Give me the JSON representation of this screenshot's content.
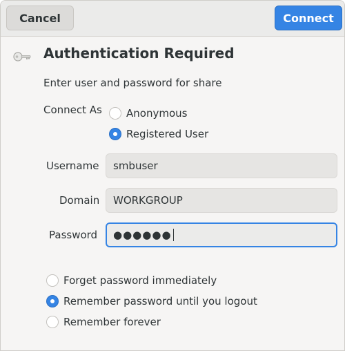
{
  "header": {
    "cancel_label": "Cancel",
    "connect_label": "Connect"
  },
  "dialog": {
    "title": "Authentication Required",
    "subtitle": "Enter user and password for share"
  },
  "connect_as": {
    "label": "Connect As",
    "options": [
      {
        "label": "Anonymous",
        "selected": false
      },
      {
        "label": "Registered User",
        "selected": true
      }
    ]
  },
  "fields": {
    "username_label": "Username",
    "username_value": "smbuser",
    "domain_label": "Domain",
    "domain_value": "WORKGROUP",
    "password_label": "Password",
    "password_masked": "●●●●●●"
  },
  "remember": {
    "options": [
      {
        "label": "Forget password immediately",
        "selected": false
      },
      {
        "label": "Remember password until you logout",
        "selected": true
      },
      {
        "label": "Remember forever",
        "selected": false
      }
    ]
  },
  "colors": {
    "accent": "#3584e4",
    "background": "#f6f5f4",
    "headerbar": "#ebebea",
    "text": "#2e3436"
  },
  "icons": {
    "dialog_icon": "key-icon"
  }
}
